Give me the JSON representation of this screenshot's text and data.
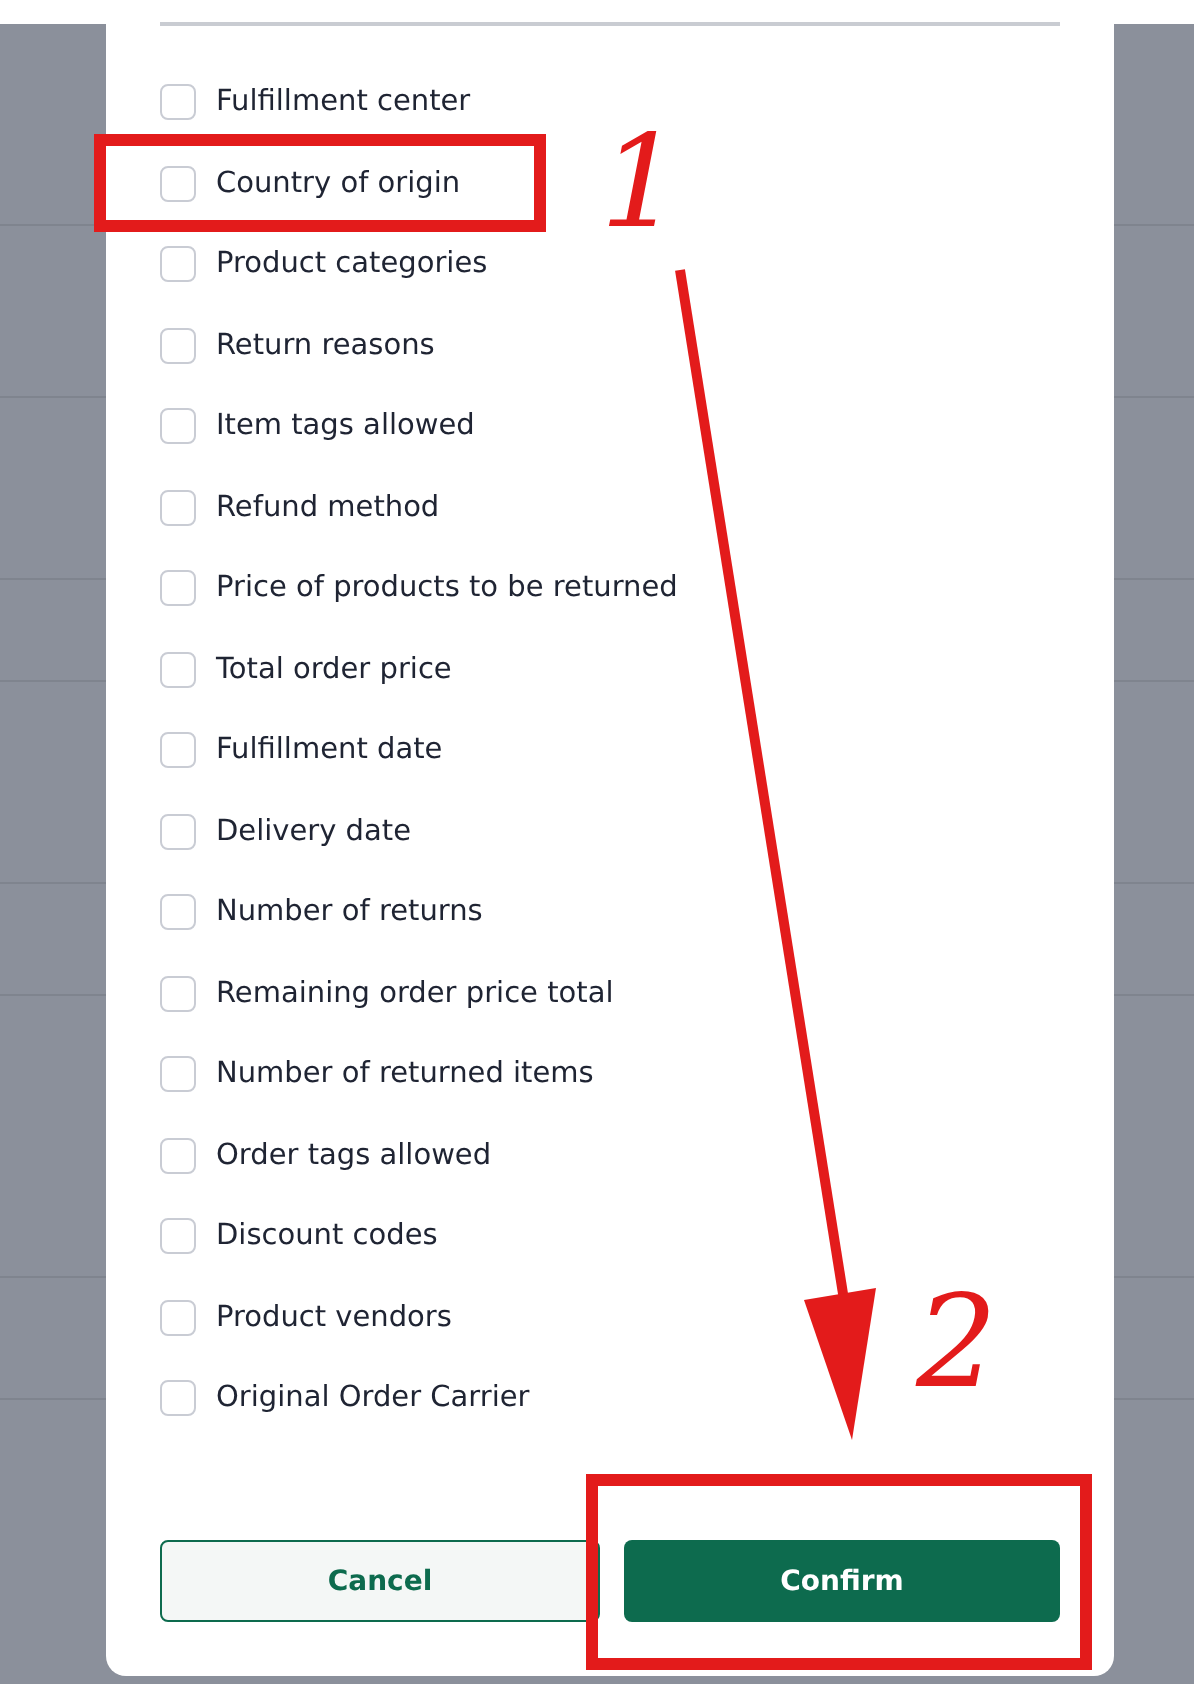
{
  "dialog": {
    "options": [
      {
        "label": "Fulfillment center",
        "checked": false
      },
      {
        "label": "Country of origin",
        "checked": false
      },
      {
        "label": "Product categories",
        "checked": false
      },
      {
        "label": "Return reasons",
        "checked": false
      },
      {
        "label": "Item tags allowed",
        "checked": false
      },
      {
        "label": "Refund method",
        "checked": false
      },
      {
        "label": "Price of products to be returned",
        "checked": false
      },
      {
        "label": "Total order price",
        "checked": false
      },
      {
        "label": "Fulfillment date",
        "checked": false
      },
      {
        "label": "Delivery date",
        "checked": false
      },
      {
        "label": "Number of returns",
        "checked": false
      },
      {
        "label": "Remaining order price total",
        "checked": false
      },
      {
        "label": "Number of returned items",
        "checked": false
      },
      {
        "label": "Order tags allowed",
        "checked": false
      },
      {
        "label": "Discount codes",
        "checked": false
      },
      {
        "label": "Product vendors",
        "checked": false
      },
      {
        "label": "Original Order Carrier",
        "checked": false
      }
    ],
    "buttons": [
      {
        "label": "Cancel",
        "kind": "secondary"
      },
      {
        "label": "Confirm",
        "kind": "primary"
      }
    ]
  },
  "annotations": [
    {
      "label": "1"
    },
    {
      "label": "2"
    }
  ]
}
